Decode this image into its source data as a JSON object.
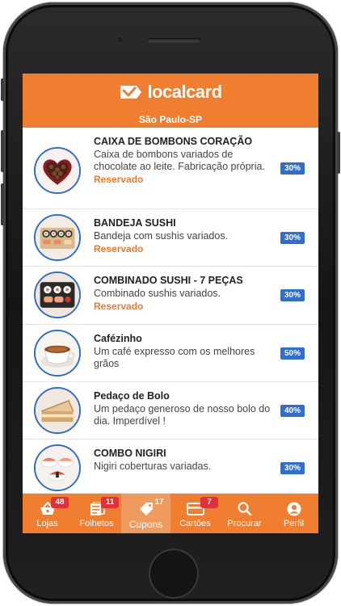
{
  "app": {
    "brand": "localcard",
    "city": "São Paulo-SP",
    "accent_color": "#f07e31",
    "badge_color": "#2f6fcb"
  },
  "offers": [
    {
      "title": "CAIXA DE BOMBONS CORAÇÃO",
      "description": "Caixa de bombons variados de chocolate ao leite. Fabricação própria.",
      "status": "Reservado",
      "discount": "30%",
      "icon": "heart-chocolate-box"
    },
    {
      "title": "BANDEJA SUSHI",
      "description": "Bandeja com sushis variados.",
      "status": "Reservado",
      "discount": "30%",
      "icon": "sushi-tray"
    },
    {
      "title": "COMBINADO SUSHI - 7 PEÇAS",
      "description": "Combinado sushis variados.",
      "status": "Reservado",
      "discount": "30%",
      "icon": "sushi-combo"
    },
    {
      "title": "Cafézinho",
      "description": "Um café expresso com os melhores grãos",
      "status": "",
      "discount": "50%",
      "icon": "coffee-cup"
    },
    {
      "title": "Pedaço de Bolo",
      "description": "Um pedaço generoso de nosso bolo do dia. Imperdível !",
      "status": "",
      "discount": "40%",
      "icon": "cake-slice"
    },
    {
      "title": "COMBO NIGIRI",
      "description": "Nigiri coberturas variadas.",
      "status": "",
      "discount": "30%",
      "icon": "nigiri"
    }
  ],
  "tabs": [
    {
      "label": "Lojas",
      "badge": "48",
      "icon": "basket-icon"
    },
    {
      "label": "Folhetos",
      "badge": "11",
      "icon": "flyer-icon"
    },
    {
      "label": "Cupons",
      "badge": "17",
      "icon": "coupon-tag-icon",
      "active": true
    },
    {
      "label": "Cartões",
      "badge": "7",
      "icon": "credit-card-icon"
    },
    {
      "label": "Procurar",
      "badge": "",
      "icon": "search-icon"
    },
    {
      "label": "Perfil",
      "badge": "",
      "icon": "profile-icon"
    }
  ]
}
